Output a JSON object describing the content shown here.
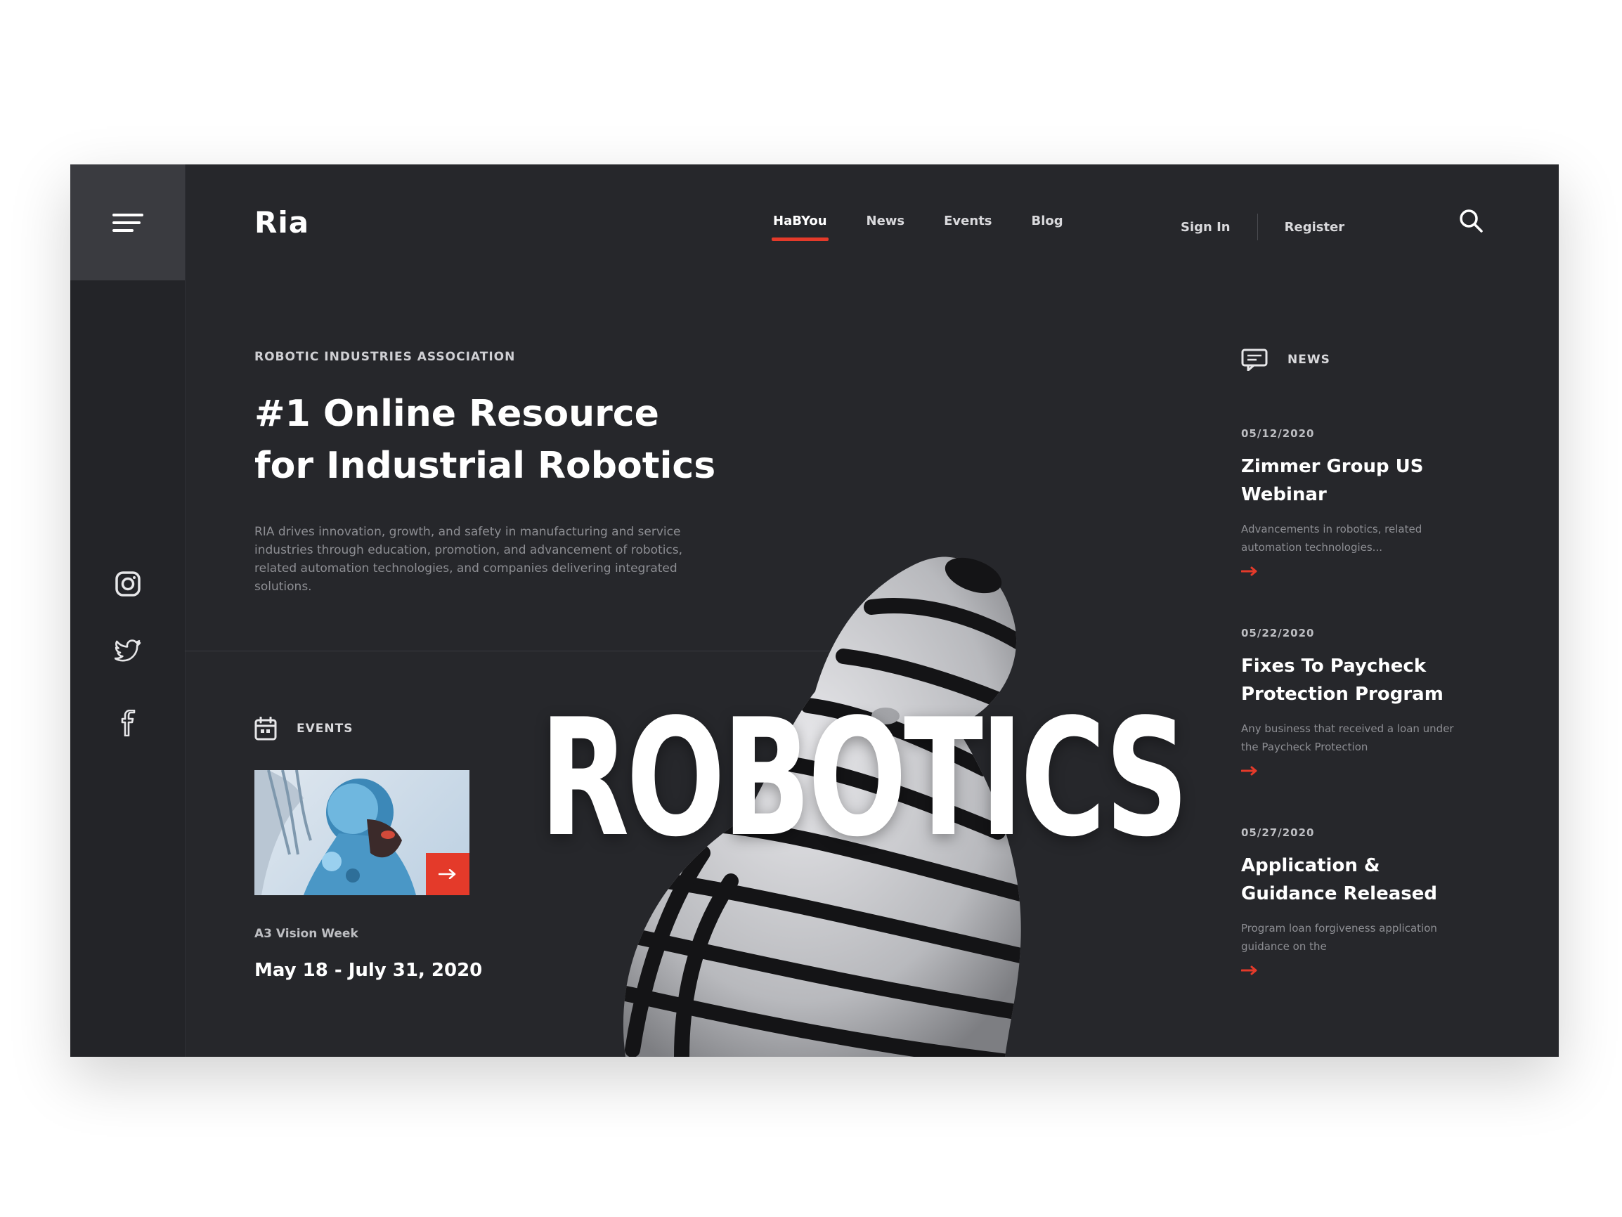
{
  "brand": "Ria",
  "nav": [
    {
      "label": "HaBYou",
      "active": true
    },
    {
      "label": "News",
      "active": false
    },
    {
      "label": "Events",
      "active": false
    },
    {
      "label": "Blog",
      "active": false
    }
  ],
  "auth": {
    "sign_in": "Sign In",
    "register": "Register"
  },
  "hero": {
    "eyebrow": "ROBOTIC INDUSTRIES ASSOCIATION",
    "title_line1": "#1 Online Resource",
    "title_line2": "for Industrial Robotics",
    "description": "RIA drives innovation, growth, and safety in manufacturing and service industries through education, promotion, and advancement of robotics, related automation technologies, and companies delivering integrated solutions.",
    "big_word": "ROBOTICS"
  },
  "events": {
    "label": "EVENTS",
    "organizer": "A3 Vision Week",
    "date": "May 18 - July 31, 2020"
  },
  "news": {
    "label": "NEWS",
    "items": [
      {
        "date": "05/12/2020",
        "title": "Zimmer Group US Webinar",
        "excerpt": "Advancements in robotics, related automation technologies..."
      },
      {
        "date": "05/22/2020",
        "title": "Fixes To Paycheck Protection Program",
        "excerpt": "Any business that received a loan under the Paycheck Protection"
      },
      {
        "date": "05/27/2020",
        "title": "Application & Guidance Released",
        "excerpt": "Program loan forgiveness application guidance on the"
      }
    ]
  },
  "colors": {
    "accent": "#e43a2a",
    "background": "#26272b",
    "sidebar": "#232428"
  },
  "icons": [
    "menu-icon",
    "instagram-icon",
    "twitter-icon",
    "facebook-icon",
    "search-icon",
    "calendar-icon",
    "news-icon",
    "arrow-right-icon"
  ]
}
